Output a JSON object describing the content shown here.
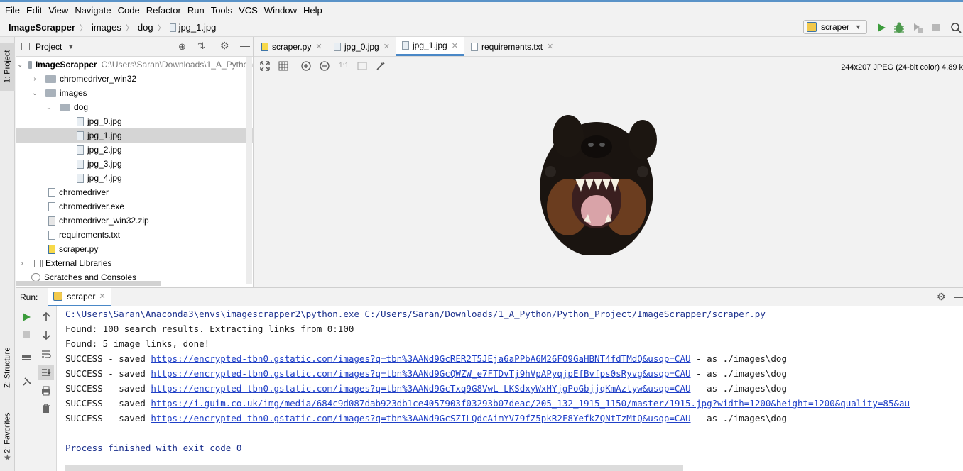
{
  "menu": [
    "File",
    "Edit",
    "View",
    "Navigate",
    "Code",
    "Refactor",
    "Run",
    "Tools",
    "VCS",
    "Window",
    "Help"
  ],
  "breadcrumb": [
    "ImageScrapper",
    "images",
    "dog",
    "jpg_1.jpg"
  ],
  "run_config": "scraper",
  "left_strip": {
    "project_tab": "1: Project",
    "structure_tab": "Z: Structure",
    "favorites_tab": "2: Favorites"
  },
  "project": {
    "title": "Project",
    "root_name": "ImageScrapper",
    "root_path": "C:\\Users\\Saran\\Downloads\\1_A_Python",
    "items": [
      {
        "label": "chromedriver_win32"
      },
      {
        "label": "images"
      },
      {
        "label": "dog"
      },
      {
        "label": "jpg_0.jpg"
      },
      {
        "label": "jpg_1.jpg"
      },
      {
        "label": "jpg_2.jpg"
      },
      {
        "label": "jpg_3.jpg"
      },
      {
        "label": "jpg_4.jpg"
      },
      {
        "label": "chromedriver"
      },
      {
        "label": "chromedriver.exe"
      },
      {
        "label": "chromedriver_win32.zip"
      },
      {
        "label": "requirements.txt"
      },
      {
        "label": "scraper.py"
      },
      {
        "label": "External Libraries"
      },
      {
        "label": "Scratches and Consoles"
      }
    ]
  },
  "tabs": [
    "scraper.py",
    "jpg_0.jpg",
    "jpg_1.jpg",
    "requirements.txt"
  ],
  "image_info": "244x207 JPEG (24-bit color) 4.89 k",
  "image_zoom_label": "1:1",
  "run": {
    "label": "Run:",
    "tab": "scraper",
    "lines": {
      "cmd": "C:\\Users\\Saran\\Anaconda3\\envs\\imagescrapper2\\python.exe C:/Users/Saran/Downloads/1_A_Python/Python_Project/ImageScrapper/scraper.py",
      "found1": "Found: 100 search results. Extracting links from 0:100",
      "found2": "Found: 5 image links, done!",
      "success_prefix": "SUCCESS - saved ",
      "success_suffix": " - as ./images\\dog",
      "urls": [
        "https://encrypted-tbn0.gstatic.com/images?q=tbn%3AANd9GcRER2T5JEja6aPPbA6M26FO9GaHBNT4fdTMdQ&usqp=CAU",
        "https://encrypted-tbn0.gstatic.com/images?q=tbn%3AANd9GcQWZW_e7FTDvTj9hVpAPyqjpEfBvfps0sRyvg&usqp=CAU",
        "https://encrypted-tbn0.gstatic.com/images?q=tbn%3AANd9GcTxq9G8VwL-LKSdxyWxHYjgPoGbjjqKmAztyw&usqp=CAU",
        "https://i.guim.co.uk/img/media/684c9d087dab923db1ce4057903f03293b07deac/205_132_1915_1150/master/1915.jpg?width=1200&height=1200&quality=85&au",
        "https://encrypted-tbn0.gstatic.com/images?q=tbn%3AANd9GcSZILQdcAimYV79fZ5pkR2F8YefkZQNtTzMtQ&usqp=CAU"
      ],
      "finished": "Process finished with exit code 0"
    }
  },
  "colors": {
    "accent": "#4a88c7",
    "run_green": "#3b9c3b",
    "link": "#1f3fc7"
  }
}
